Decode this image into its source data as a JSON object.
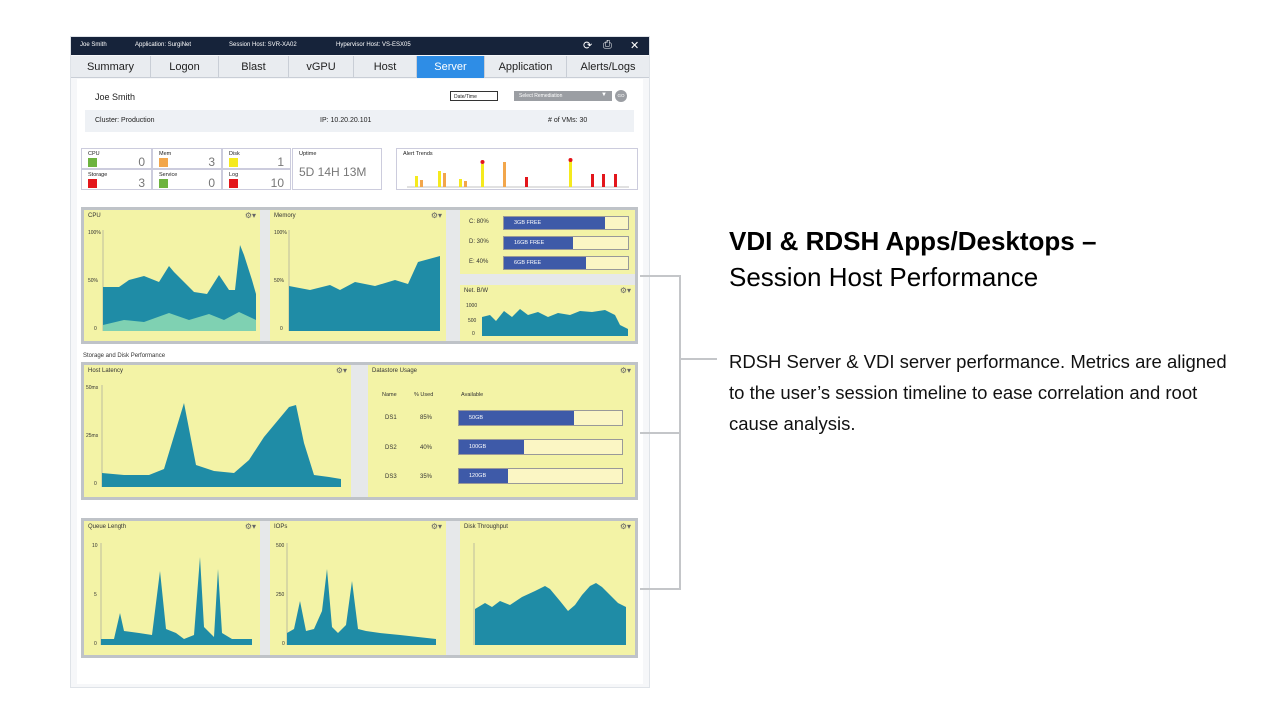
{
  "topbar": {
    "user": "Joe Smith",
    "application": "Application: SurgiNet",
    "session_host": "Session Host: SVR-XA02",
    "hypervisor_host": "Hypervisor Host: VS-ESX05"
  },
  "tabs": [
    "Summary",
    "Logon",
    "Blast",
    "vGPU",
    "Host",
    "Server",
    "Application",
    "Alerts/Logs"
  ],
  "active_tab": "Server",
  "header": {
    "user_name": "Joe Smith",
    "date_time_label": "Date/Time",
    "remediation_select": "Select Remediation",
    "go_label": "GO",
    "cluster": "Cluster: Production",
    "ip": "IP: 10.20.20.101",
    "vms": "# of VMs: 30"
  },
  "stats": {
    "cpu": {
      "label": "CPU",
      "value": "0",
      "color": "#6db33f"
    },
    "mem": {
      "label": "Mem",
      "value": "3",
      "color": "#f2a64b"
    },
    "disk": {
      "label": "Disk",
      "value": "1",
      "color": "#f5ea1e"
    },
    "storage": {
      "label": "Storage",
      "value": "3",
      "color": "#e3161b"
    },
    "service": {
      "label": "Service",
      "value": "0",
      "color": "#6db33f"
    },
    "log": {
      "label": "Log",
      "value": "10",
      "color": "#e3161b"
    },
    "uptime": {
      "label": "Uptime",
      "value": "5D 14H 13M"
    },
    "alert_trends": {
      "label": "Alert Trends"
    }
  },
  "widgets": {
    "cpu": {
      "title": "CPU",
      "y_top": "100%",
      "y_mid": "50%",
      "y_bot": "0"
    },
    "memory": {
      "title": "Memory",
      "y_top": "100%",
      "y_mid": "50%",
      "y_bot": "0"
    },
    "drives": [
      {
        "label": "C:  80%",
        "free": "3GB FREE",
        "pct": 0.8
      },
      {
        "label": "D:  30%",
        "free": "16GB FREE",
        "pct": 0.55
      },
      {
        "label": "E:  40%",
        "free": "6GB FREE",
        "pct": 0.65
      }
    ],
    "netbw": {
      "title": "Net. B/W",
      "y_top": "1000",
      "y_mid": "500",
      "y_bot": "0"
    },
    "section_label": "Storage and Disk Performance",
    "host_latency": {
      "title": "Host Latency",
      "y_top": "50ms",
      "y_mid": "25ms",
      "y_bot": "0"
    },
    "datastore": {
      "title": "Datastore Usage",
      "col_name": "Name",
      "col_used": "% Used",
      "col_avail": "Available",
      "rows": [
        {
          "name": "DS1",
          "used": "85%",
          "avail": "50GB",
          "pct": 0.72
        },
        {
          "name": "DS2",
          "used": "40%",
          "avail": "100GB",
          "pct": 0.4
        },
        {
          "name": "DS3",
          "used": "35%",
          "avail": "120GB",
          "pct": 0.3
        }
      ]
    },
    "queue_length": {
      "title": "Queue Length",
      "y_top": "10",
      "y_mid": "5",
      "y_bot": "0"
    },
    "iops": {
      "title": "IOPs",
      "y_top": "500",
      "y_mid": "250",
      "y_bot": "0"
    },
    "disk_throughput": {
      "title": "Disk Throughput"
    }
  },
  "right": {
    "title": "VDI & RDSH Apps/Desktops –",
    "subtitle": "Session Host Performance",
    "body": "RDSH Server & VDI server performance. Metrics are aligned to the user’s session timeline to ease correlation and root cause analysis."
  },
  "colors": {
    "teal": "#1f8ca6",
    "mint": "#7fd1b2",
    "panel_yellow": "#f3f3a6",
    "tab_active": "#2e8de6",
    "bar_blue": "#3e5aa8"
  }
}
